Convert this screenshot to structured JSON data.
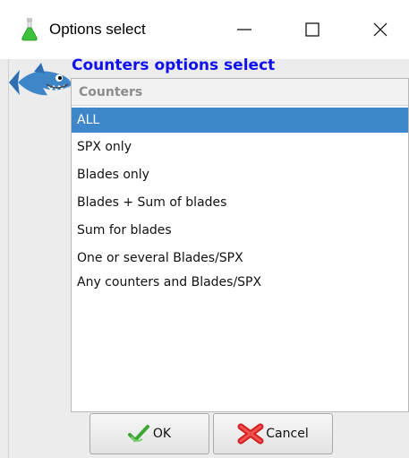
{
  "window": {
    "title": "Options select",
    "controls": [
      "minimize",
      "maximize",
      "close"
    ]
  },
  "dialog": {
    "heading": "Counters options select",
    "list_header": "Counters",
    "items": [
      {
        "label": "ALL",
        "selected": true
      },
      {
        "label": "SPX only",
        "selected": false
      },
      {
        "label": "Blades only",
        "selected": false
      },
      {
        "label": "Blades + Sum of blades",
        "selected": false
      },
      {
        "label": "Sum for blades",
        "selected": false
      },
      {
        "label": "One or several Blades/SPX",
        "selected": false
      },
      {
        "label": "Any counters and Blades/SPX",
        "selected": false
      }
    ],
    "buttons": {
      "ok_label": "OK",
      "cancel_label": "Cancel"
    }
  },
  "icons": {
    "app": "flask-icon",
    "mascot": "shark-icon",
    "ok": "green-check-arrow-icon",
    "cancel": "red-x-icon"
  },
  "colors": {
    "heading": "#1010ee",
    "selection": "#3d86c9",
    "header_text": "#8c8c8c"
  }
}
